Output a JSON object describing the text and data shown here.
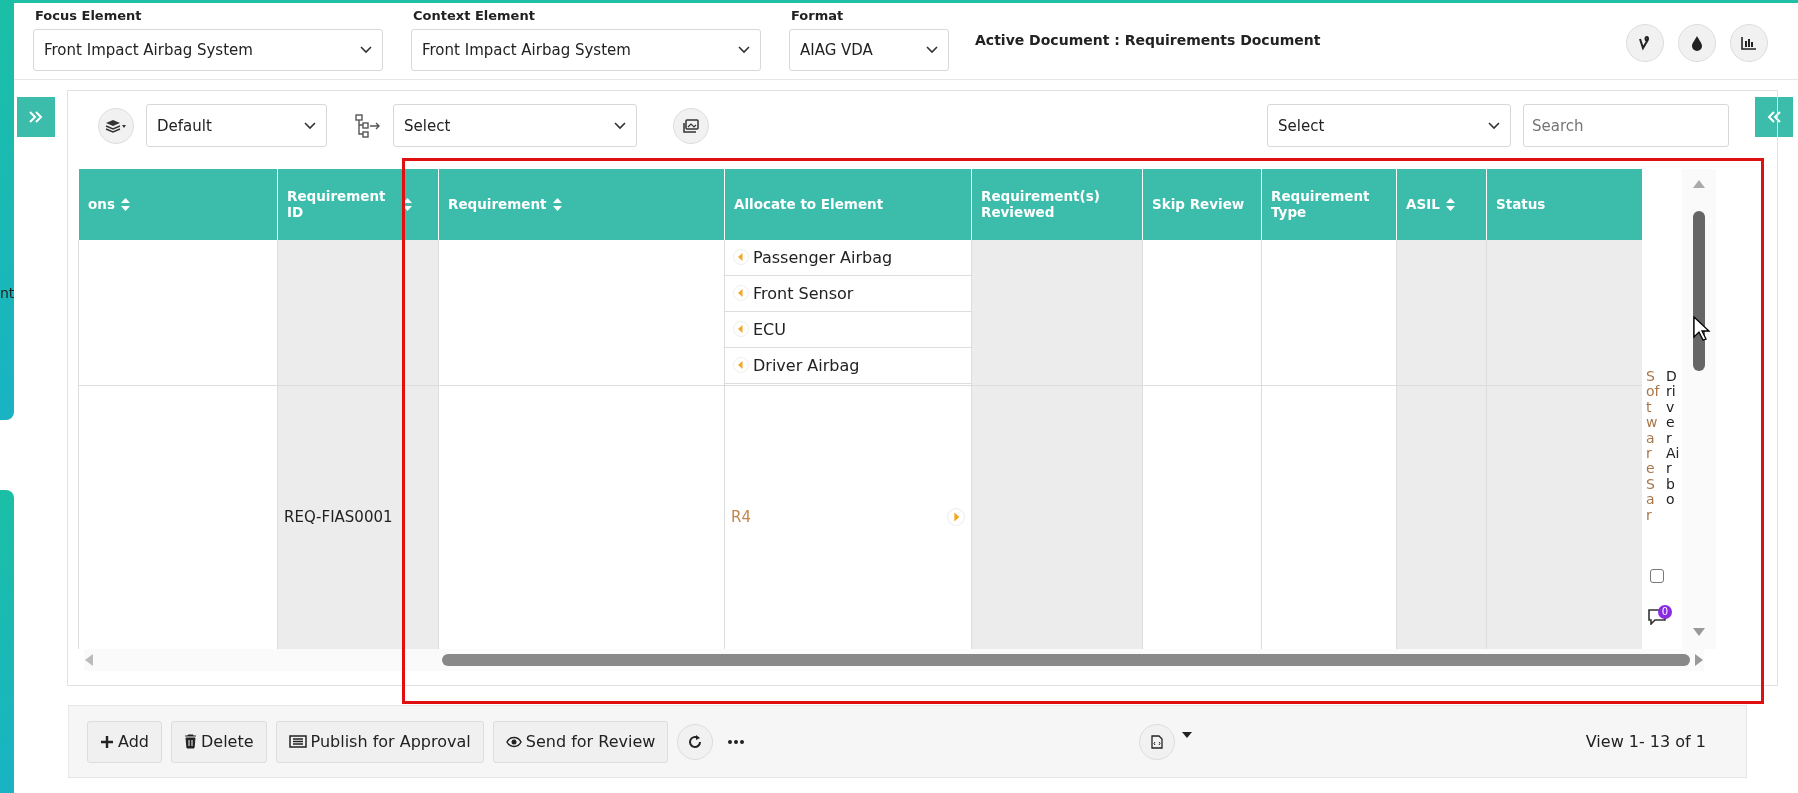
{
  "filters": [
    {
      "label": "Focus Element",
      "value": "Front Impact Airbag System"
    },
    {
      "label": "Context Element",
      "value": "Front Impact Airbag System"
    },
    {
      "label": "Format",
      "value": "AIAG VDA"
    }
  ],
  "active_document": "Active Document : Requirements Document",
  "side_text": "nt",
  "toolbar": {
    "view_select": "Default",
    "group_select": "Select",
    "filter_select": "Select",
    "search": {
      "placeholder": "Search"
    }
  },
  "table": {
    "columns": [
      {
        "label": "ons",
        "sortable": true,
        "shade": false
      },
      {
        "label": "Requirement ID",
        "sortable": true,
        "shade": true
      },
      {
        "label": "Requirement",
        "sortable": true,
        "shade": false
      },
      {
        "label": "Allocate to Element",
        "sortable": false,
        "shade": false
      },
      {
        "label": "Requirement(s) Reviewed",
        "sortable": false,
        "shade": true
      },
      {
        "label": "Skip Review",
        "sortable": false,
        "shade": false
      },
      {
        "label": "Requirement Type",
        "sortable": false,
        "shade": false
      },
      {
        "label": "ASIL",
        "sortable": true,
        "shade": true
      },
      {
        "label": "Status",
        "sortable": false,
        "shade": true
      }
    ],
    "rows": [
      {
        "requirement_id": "",
        "elements": [
          "Passenger Airbag",
          "Front Sensor",
          "ECU",
          "Driver Airbag"
        ],
        "link": ""
      },
      {
        "requirement_id": "REQ-FIAS0001",
        "elements": [],
        "link": "R4"
      }
    ],
    "overflow_texts": [
      {
        "text": "Software Sar",
        "color": "#a8764a"
      },
      {
        "text": "Driver Airbo",
        "color": "#222222"
      }
    ],
    "row_checkbox": {
      "checked": false
    },
    "comment_count": "0"
  },
  "actions": [
    "Add",
    "Delete",
    "Publish for Approval",
    "Send for Review"
  ],
  "pager": "View 1- 13 of 1"
}
